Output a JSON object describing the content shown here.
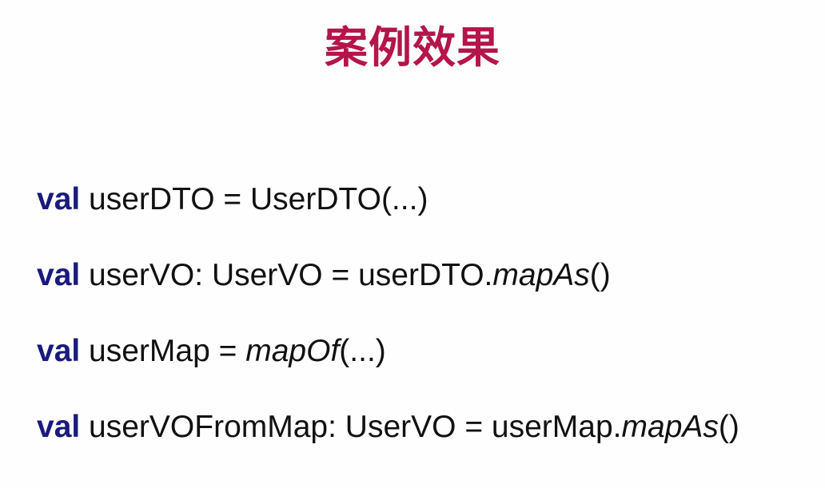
{
  "slide": {
    "title": "案例效果",
    "accent_color": "#b4154a",
    "keyword_color": "#1a1a7c",
    "lines": [
      {
        "keyword": "val",
        "before_call": " userDTO = UserDTO(...)",
        "call": "",
        "after_call": ""
      },
      {
        "keyword": "val",
        "before_call": " userVO: UserVO = userDTO.",
        "call": "mapAs",
        "after_call": "()"
      },
      {
        "keyword": "val",
        "before_call": " userMap = ",
        "call": "mapOf",
        "after_call": "(...)"
      },
      {
        "keyword": "val",
        "before_call": " userVOFromMap: UserVO = userMap.",
        "call": "mapAs",
        "after_call": "()"
      }
    ]
  }
}
